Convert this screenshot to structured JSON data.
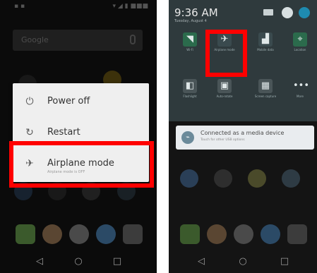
{
  "left_screen": {
    "search_placeholder": "Google",
    "power_menu": {
      "power_off": "Power off",
      "restart": "Restart",
      "airplane_mode": "Airplane mode",
      "airplane_mode_status": "Airplane mode is OFF"
    }
  },
  "right_screen": {
    "time": "9:36 AM",
    "date": "Tuesday, August 4",
    "quick_settings": [
      {
        "label": "Wi-Fi",
        "icon": "wifi-icon"
      },
      {
        "label": "Airplane mode",
        "icon": "airplane-icon"
      },
      {
        "label": "Mobile data",
        "icon": "signal-icon"
      },
      {
        "label": "Location",
        "icon": "location-icon"
      },
      {
        "label": "Flashlight",
        "icon": "flashlight-icon"
      },
      {
        "label": "Auto-rotate",
        "icon": "rotate-icon"
      },
      {
        "label": "Screen capture",
        "icon": "screenshot-icon"
      },
      {
        "label": "More",
        "icon": "more-icon"
      }
    ],
    "notification": {
      "title": "Connected as a media device",
      "subtitle": "Touch for other USB options"
    }
  },
  "colors": {
    "highlight": "#ff0000",
    "menu_background": "#efefef",
    "quick_settings_background": "#2f3a3d"
  }
}
